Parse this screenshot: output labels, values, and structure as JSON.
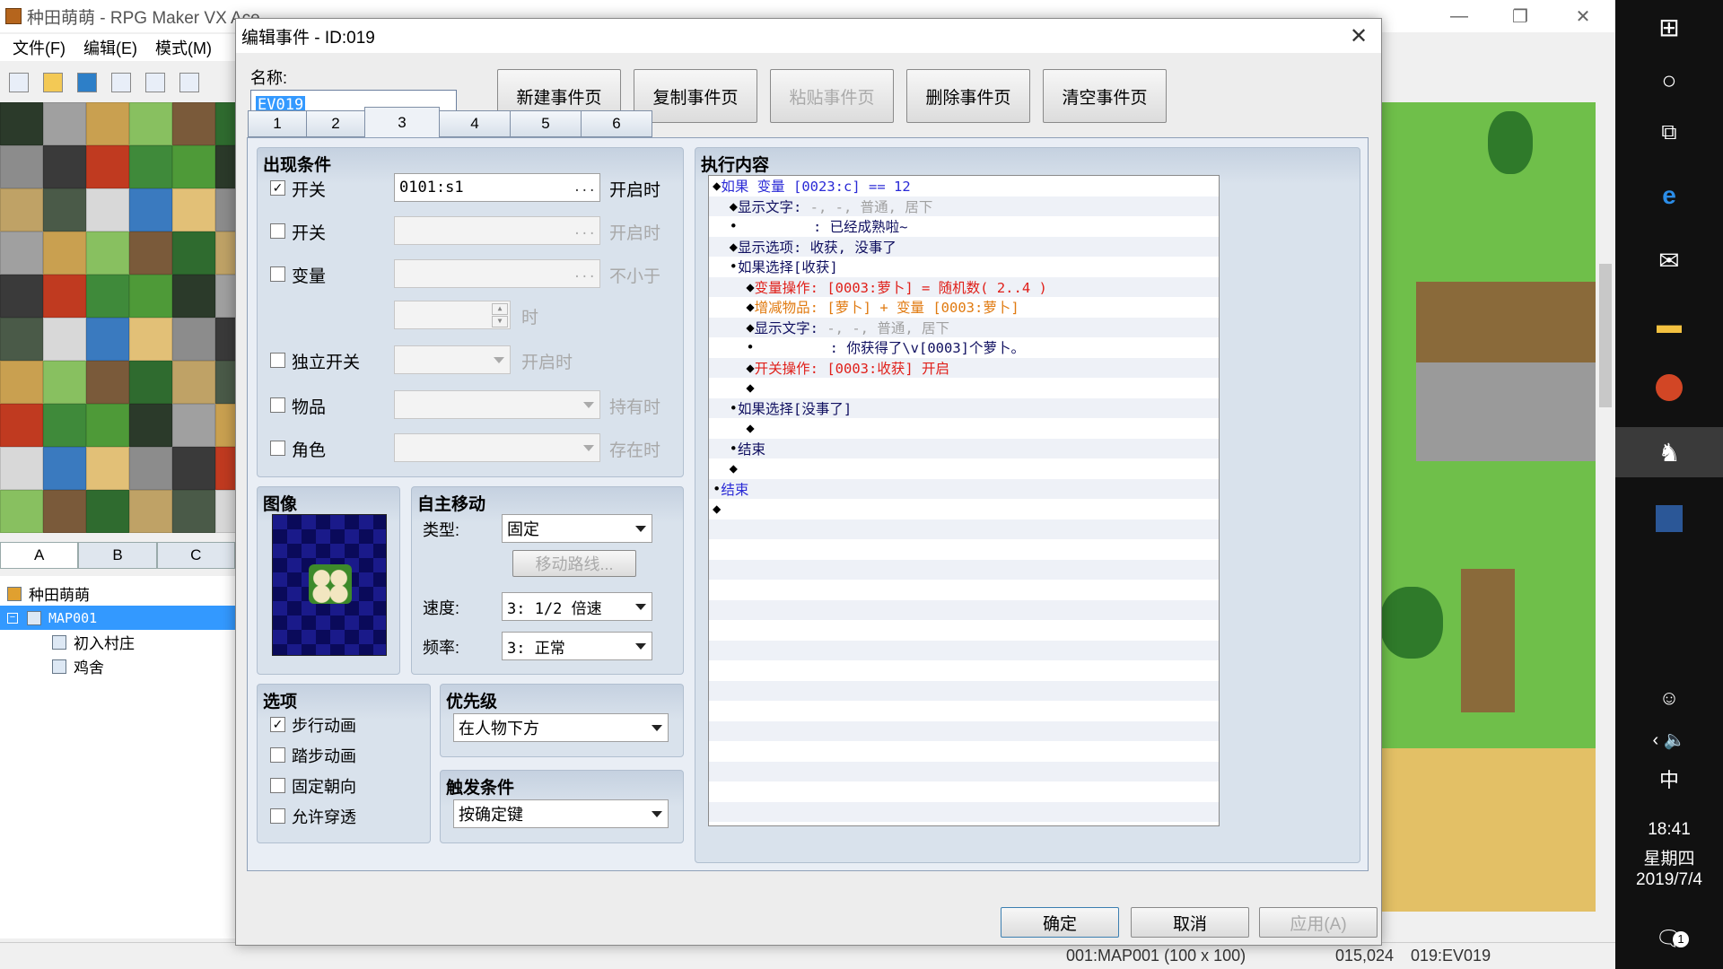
{
  "app": {
    "title": "种田萌萌 - RPG Maker VX Ace",
    "menus": [
      "文件(F)",
      "编辑(E)",
      "模式(M)"
    ],
    "tile_tabs": [
      "A",
      "B",
      "C"
    ],
    "tree": {
      "project": "种田萌萌",
      "map": "MAP001",
      "children": [
        "初入村庄",
        "鸡舍"
      ]
    },
    "status": {
      "map": "001:MAP001 (100 x 100)",
      "coords": "015,024",
      "event": "019:EV019"
    }
  },
  "dialog": {
    "title": "编辑事件 - ID:019",
    "name_label": "名称:",
    "name_value": "EV019",
    "buttons": {
      "new_page": "新建事件页",
      "copy_page": "复制事件页",
      "paste_page": "粘贴事件页",
      "delete_page": "删除事件页",
      "clear_page": "清空事件页"
    },
    "page_tabs": [
      "1",
      "2",
      "3",
      "4",
      "5",
      "6"
    ],
    "active_tab": "3",
    "conditions": {
      "title": "出现条件",
      "switch1": {
        "label": "开关",
        "checked": true,
        "value": "0101:s1",
        "suffix": "开启时"
      },
      "switch2": {
        "label": "开关",
        "checked": false,
        "value": "",
        "suffix": "开启时"
      },
      "variable": {
        "label": "变量",
        "checked": false,
        "value": "",
        "suffix": "不小于"
      },
      "variable_num_suffix": "时",
      "self_switch": {
        "label": "独立开关",
        "checked": false,
        "suffix": "开启时"
      },
      "item": {
        "label": "物品",
        "checked": false,
        "suffix": "持有时"
      },
      "actor": {
        "label": "角色",
        "checked": false,
        "suffix": "存在时"
      },
      "dots": "..."
    },
    "image": {
      "title": "图像"
    },
    "autonomous": {
      "title": "自主移动",
      "type_label": "类型:",
      "type_value": "固定",
      "route_button": "移动路线...",
      "speed_label": "速度:",
      "speed_value": "3: 1/2 倍速",
      "freq_label": "频率:",
      "freq_value": "3: 正常"
    },
    "options": {
      "title": "选项",
      "items": [
        {
          "label": "步行动画",
          "checked": true
        },
        {
          "label": "踏步动画",
          "checked": false
        },
        {
          "label": "固定朝向",
          "checked": false
        },
        {
          "label": "允许穿透",
          "checked": false
        }
      ]
    },
    "priority": {
      "title": "优先级",
      "value": "在人物下方"
    },
    "trigger": {
      "title": "触发条件",
      "value": "按确定键"
    },
    "contents": {
      "title": "执行内容",
      "lines": [
        {
          "prefix": "◆",
          "text": "如果 变量 [0023:c] == 12",
          "color": "blue"
        },
        {
          "prefix": "  ◆",
          "text": "显示文字:",
          "extra": "-, -, 普通, 居下",
          "color": "navy"
        },
        {
          "prefix": "  •",
          "text": "         : 已经成熟啦~",
          "color": "navy"
        },
        {
          "prefix": "  ◆",
          "text": "显示选项: 收获, 没事了",
          "color": "navy"
        },
        {
          "prefix": "  •",
          "text": "如果选择[收获]",
          "color": "navy"
        },
        {
          "prefix": "    ◆",
          "text": "变量操作: [0003:萝卜] = 随机数( 2..4 )",
          "color": "red"
        },
        {
          "prefix": "    ◆",
          "text": "增减物品: [萝卜] + 变量 [0003:萝卜]",
          "color": "orange"
        },
        {
          "prefix": "    ◆",
          "text": "显示文字:",
          "extra": "-, -, 普通, 居下",
          "color": "navy"
        },
        {
          "prefix": "    •",
          "text": "         : 你获得了\\v[0003]个萝卜。",
          "color": "navy"
        },
        {
          "prefix": "    ◆",
          "text": "开关操作: [0003:收获] 开启",
          "color": "red"
        },
        {
          "prefix": "    ◆",
          "text": "",
          "color": "navy"
        },
        {
          "prefix": "  •",
          "text": "如果选择[没事了]",
          "color": "navy"
        },
        {
          "prefix": "    ◆",
          "text": "",
          "color": "navy"
        },
        {
          "prefix": "  •",
          "text": "结束",
          "color": "navy"
        },
        {
          "prefix": "  ◆",
          "text": "",
          "color": "navy"
        },
        {
          "prefix": "•",
          "text": "结束",
          "color": "blue"
        },
        {
          "prefix": "◆",
          "text": "",
          "color": "navy"
        }
      ]
    },
    "footer": {
      "ok": "确定",
      "cancel": "取消",
      "apply": "应用(A)"
    }
  },
  "taskbar": {
    "time": "18:41",
    "weekday": "星期四",
    "date": "2019/7/4",
    "ime": "中",
    "notification_count": "1"
  }
}
